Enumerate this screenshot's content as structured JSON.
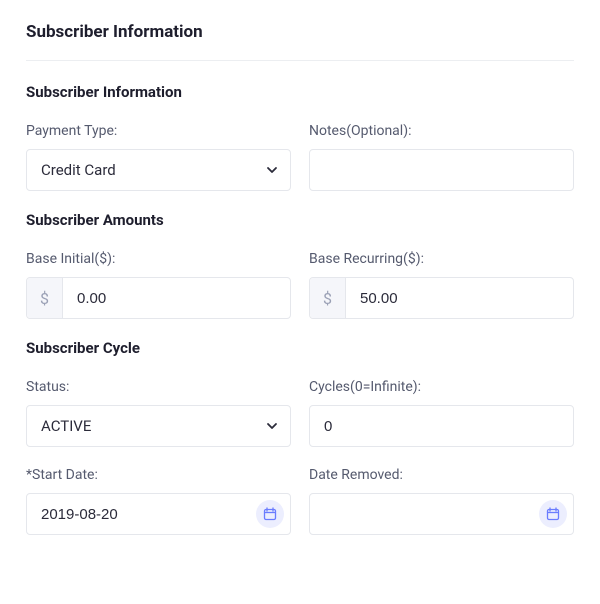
{
  "page": {
    "title": "Subscriber Information"
  },
  "sections": {
    "info": {
      "title": "Subscriber Information",
      "payment_type": {
        "label": "Payment Type:",
        "value": "Credit Card"
      },
      "notes": {
        "label": "Notes(Optional):",
        "value": ""
      }
    },
    "amounts": {
      "title": "Subscriber Amounts",
      "base_initial": {
        "label": "Base Initial($):",
        "prefix": "$",
        "value": "0.00"
      },
      "base_recurring": {
        "label": "Base Recurring($):",
        "prefix": "$",
        "value": "50.00"
      }
    },
    "cycle": {
      "title": "Subscriber Cycle",
      "status": {
        "label": "Status:",
        "value": "ACTIVE"
      },
      "cycles": {
        "label": "Cycles(0=Infinite):",
        "value": "0"
      },
      "start_date": {
        "label": "*Start Date:",
        "value": "2019-08-20"
      },
      "date_removed": {
        "label": "Date Removed:",
        "value": ""
      }
    }
  }
}
